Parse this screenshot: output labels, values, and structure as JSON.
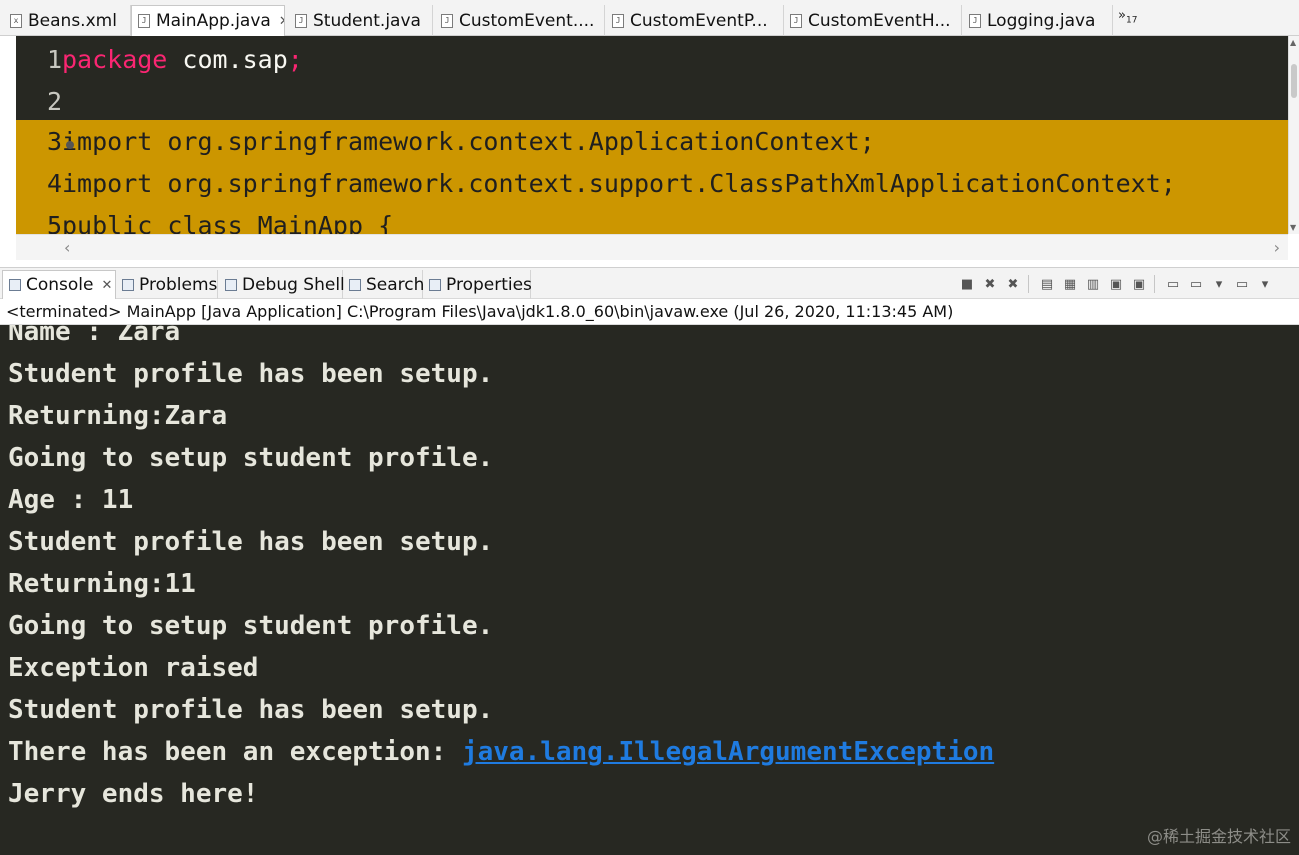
{
  "editor_tabs": [
    {
      "label": "Beans.xml",
      "icon": "xml-file-icon",
      "active": false
    },
    {
      "label": "MainApp.java",
      "icon": "java-file-icon",
      "active": true
    },
    {
      "label": "Student.java",
      "icon": "java-file-icon",
      "active": false
    },
    {
      "label": "CustomEvent....",
      "icon": "java-file-icon",
      "active": false
    },
    {
      "label": "CustomEventP...",
      "icon": "java-file-icon",
      "active": false
    },
    {
      "label": "CustomEventH...",
      "icon": "java-file-icon",
      "active": false
    },
    {
      "label": "Logging.java",
      "icon": "java-file-icon",
      "active": false
    }
  ],
  "tab_overflow": {
    "symbol": "»",
    "count": "17"
  },
  "editor": {
    "lines": [
      {
        "num": "1",
        "keyword": "package",
        "text": " com.sap",
        "punct": ";"
      },
      {
        "num": "2",
        "keyword": "",
        "text": "",
        "punct": ""
      },
      {
        "num": "3",
        "keyword": "",
        "text": "import org.springframework.context.ApplicationContext;",
        "punct": ""
      },
      {
        "num": "4",
        "keyword": "",
        "text": "import org.springframework.context.support.ClassPathXmlApplicationContext;",
        "punct": ""
      },
      {
        "num": "5",
        "keyword": "",
        "text": "public class MainApp {",
        "punct": ""
      }
    ],
    "highlight_color": "#cc9600",
    "background": "#272822"
  },
  "view_tabs": [
    {
      "label": "Console",
      "active": true
    },
    {
      "label": "Problems",
      "active": false
    },
    {
      "label": "Debug Shell",
      "active": false
    },
    {
      "label": "Search",
      "active": false
    },
    {
      "label": "Properties",
      "active": false
    }
  ],
  "console": {
    "status": "<terminated> MainApp [Java Application] C:\\Program Files\\Java\\jdk1.8.0_60\\bin\\javaw.exe (Jul 26, 2020, 11:13:45 AM)",
    "lines": [
      "Name : Zara",
      "Student profile has been setup.",
      "Returning:Zara",
      "Going to setup student profile.",
      "Age : 11",
      "Student profile has been setup.",
      "Returning:11",
      "Going to setup student profile.",
      "Exception raised",
      "Student profile has been setup.",
      "There has been an exception: ",
      "Jerry ends here!"
    ],
    "exception_link": "java.lang.IllegalArgumentException",
    "link_color": "#1f7be0"
  },
  "watermark": "@稀土掘金技术社区"
}
